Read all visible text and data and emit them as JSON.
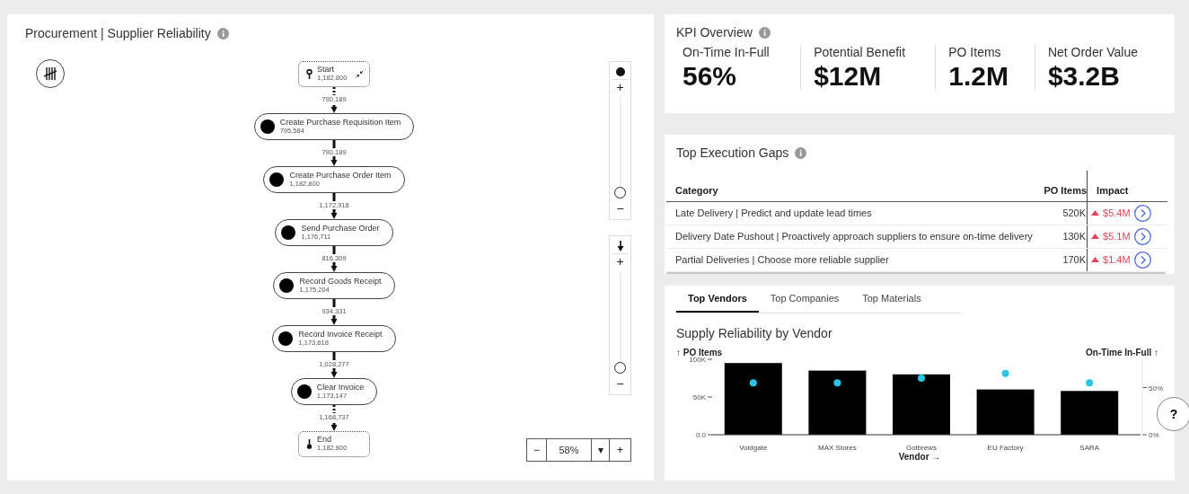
{
  "process_panel": {
    "title": "Procurement | Supplier Reliability",
    "nodes": [
      {
        "kind": "start",
        "label": "Start",
        "count": "1,182,800"
      },
      {
        "kind": "activity",
        "label": "Create Purchase Requisition Item",
        "count": "795,584"
      },
      {
        "kind": "activity",
        "label": "Create Purchase Order Item",
        "count": "1,182,800"
      },
      {
        "kind": "activity",
        "label": "Send Purchase Order",
        "count": "1,176,711"
      },
      {
        "kind": "activity",
        "label": "Record Goods Receipt",
        "count": "1,175,204"
      },
      {
        "kind": "activity",
        "label": "Record Invoice Receipt",
        "count": "1,173,618"
      },
      {
        "kind": "activity",
        "label": "Clear Invoice",
        "count": "1,173,147"
      },
      {
        "kind": "end",
        "label": "End",
        "count": "1,182,800"
      }
    ],
    "edges": [
      {
        "kind": "dotted",
        "label": "790,189"
      },
      {
        "kind": "solid",
        "label": "790,189"
      },
      {
        "kind": "solid",
        "label": "1,172,918"
      },
      {
        "kind": "solid",
        "label": "816,309"
      },
      {
        "kind": "solid",
        "label": "934,331"
      },
      {
        "kind": "solid",
        "label": "1,028,277"
      },
      {
        "kind": "dotted",
        "label": "1,168,737"
      }
    ],
    "sliders": [
      {
        "kind": "activities",
        "plus": "+",
        "minus": "−",
        "level": 0
      },
      {
        "kind": "connections",
        "plus": "+",
        "minus": "−",
        "level": 0
      }
    ],
    "zoom": {
      "minus": "−",
      "value": "58%",
      "dropdown": "▾",
      "plus": "+"
    }
  },
  "kpi_overview": {
    "title": "KPI Overview",
    "tiles": [
      {
        "label": "On-Time In-Full",
        "value": "56%"
      },
      {
        "label": "Potential Benefit",
        "value": "$12M"
      },
      {
        "label": "PO Items",
        "value": "1.2M"
      },
      {
        "label": "Net Order Value",
        "value": "$3.2B"
      }
    ]
  },
  "execution_gaps": {
    "title": "Top Execution Gaps",
    "columns": [
      "Category",
      "PO Items",
      "Impact"
    ],
    "rows": [
      {
        "category": "Late Delivery | Predict and update lead times",
        "po_items": "520K",
        "impact": "$5.4M"
      },
      {
        "category": "Delivery Date Pushout | Proactively approach suppliers to ensure on-time delivery",
        "po_items": "130K",
        "impact": "$5.1M"
      },
      {
        "category": "Partial Deliveries | Choose more reliable supplier",
        "po_items": "170K",
        "impact": "$1.4M"
      }
    ]
  },
  "vendors": {
    "tabs": [
      {
        "label": "Top Vendors",
        "selected": true
      },
      {
        "label": "Top Companies",
        "selected": false
      },
      {
        "label": "Top Materials",
        "selected": false
      }
    ],
    "title": "Supply Reliability by Vendor",
    "chart_data": {
      "type": "bar",
      "xlabel": "Vendor →",
      "ylabel": "↑ PO Items",
      "y2label": "On-Time In-Full ↑",
      "categories": [
        "Voidgate",
        "MAX Stores",
        "Golbrews",
        "EU Factory",
        "SARA"
      ],
      "series": [
        {
          "color": "#000000",
          "values": [
            95000,
            85000,
            80000,
            60000,
            58000
          ]
        },
        {
          "color": "#29c5e6",
          "values": [
            55,
            55,
            60,
            65,
            55
          ]
        }
      ],
      "ylim": [
        0,
        100000
      ],
      "yticks": [
        {
          "value": 0,
          "label": "0.0"
        },
        {
          "value": 50000,
          "label": "50K"
        },
        {
          "value": 100000,
          "label": "100K"
        }
      ],
      "y2lim": [
        0,
        80
      ],
      "y2ticks": [
        {
          "value": 0,
          "label": "0%"
        },
        {
          "value": 50,
          "label": "50%"
        }
      ]
    }
  },
  "help_button": {
    "label": "?"
  }
}
